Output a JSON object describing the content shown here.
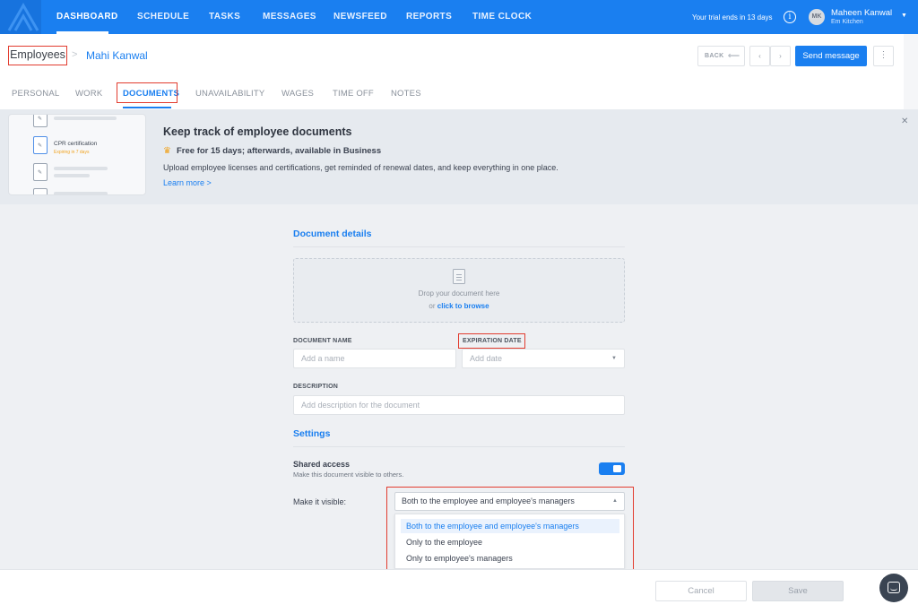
{
  "nav": {
    "items": [
      "DASHBOARD",
      "SCHEDULE",
      "TASKS",
      "MESSAGES",
      "NEWSFEED",
      "REPORTS",
      "TIME CLOCK"
    ],
    "trial_text": "Your trial ends in 13 days",
    "info_glyph": "i",
    "user": {
      "initials": "MK",
      "name": "Maheen Kanwal",
      "location": "Em Kitchen"
    }
  },
  "breadcrumb": {
    "root": "Employees",
    "separator": ">",
    "current": "Mahi Kanwal"
  },
  "header_actions": {
    "back": "BACK",
    "send_message": "Send message"
  },
  "tabs": [
    "PERSONAL",
    "WORK",
    "DOCUMENTS",
    "UNAVAILABILITY",
    "WAGES",
    "TIME OFF",
    "NOTES"
  ],
  "promo": {
    "card_title": "CPR certification",
    "card_sub": "Expiring in 7 days",
    "title": "Keep track of employee documents",
    "subtitle": "Free for 15 days; afterwards, available in Business",
    "description": "Upload employee licenses and certifications, get reminded of renewal dates, and keep everything in one place.",
    "link": "Learn more >"
  },
  "form": {
    "section_details": "Document details",
    "drop_text": "Drop your document here",
    "drop_or": "or",
    "drop_browse": "click to browse",
    "doc_name_label": "DOCUMENT NAME",
    "doc_name_placeholder": "Add a name",
    "exp_date_label": "EXPIRATION DATE",
    "exp_date_placeholder": "Add date",
    "desc_label": "DESCRIPTION",
    "desc_placeholder": "Add description for the document",
    "section_settings": "Settings",
    "shared_label": "Shared access",
    "shared_sub": "Make this document visible to others.",
    "visible_label": "Make it visible:",
    "visible_selected": "Both to the employee and employee's managers",
    "visible_options": [
      "Both to the employee and employee's managers",
      "Only to the employee",
      "Only to employee's managers"
    ]
  },
  "footer": {
    "cancel": "Cancel",
    "save": "Save"
  },
  "colors": {
    "brand": "#1a7ff0",
    "highlight": "#e23c2f"
  }
}
